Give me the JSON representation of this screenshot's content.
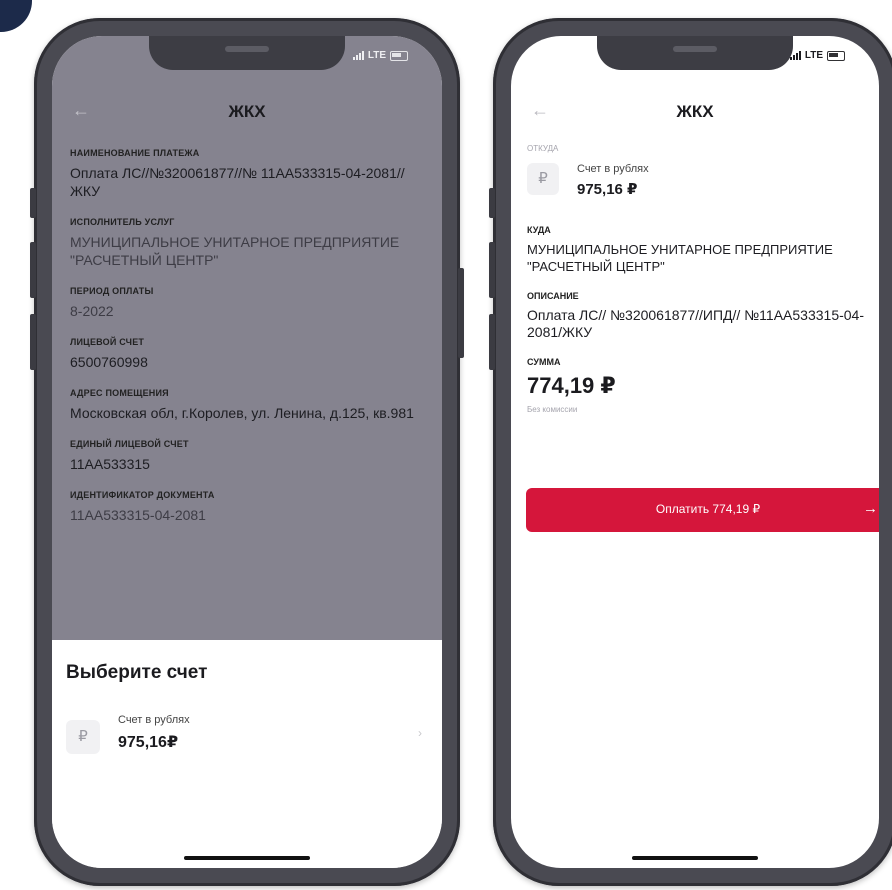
{
  "status": {
    "network": "LTE"
  },
  "left_screen": {
    "title": "ЖКХ",
    "fields": [
      {
        "label": "НАИМЕНОВАНИЕ ПЛАТЕЖА",
        "value": "Оплата ЛС//№320061877//№ 11АА533315-04-2081//ЖКУ"
      },
      {
        "label": "ИСПОЛНИТЕЛЬ УСЛУГ",
        "value": "МУНИЦИПАЛЬНОЕ УНИТАРНОЕ ПРЕДПРИЯТИЕ \"РАСЧЕТНЫЙ ЦЕНТР\""
      },
      {
        "label": "ПЕРИОД ОПЛАТЫ",
        "value": "8-2022"
      },
      {
        "label": "ЛИЦЕВОЙ СЧЕТ",
        "value": "6500760998"
      },
      {
        "label": "АДРЕС ПОМЕЩЕНИЯ",
        "value": "Московская обл, г.Королев, ул. Ленина, д.125, кв.981"
      },
      {
        "label": "ЕДИНЫЙ ЛИЦЕВОЙ СЧЕТ",
        "value": "11АА533315"
      },
      {
        "label": "ИДЕНТИФИКАТОР ДОКУМЕНТА",
        "value": "11АА533315-04-2081"
      }
    ],
    "sheet_title": "Выберите счет",
    "account": {
      "currency_symbol": "₽",
      "name": "Счет в рублях",
      "amount": "975,16₽"
    }
  },
  "right_screen": {
    "title": "ЖКХ",
    "from_label": "ОТКУДА",
    "account": {
      "currency_symbol": "₽",
      "name": "Счет в рублях",
      "amount": "975,16 ₽"
    },
    "to_label": "КУДА",
    "to_value": "МУНИЦИПАЛЬНОЕ УНИТАРНОЕ ПРЕДПРИЯТИЕ \"РАСЧЕТНЫЙ ЦЕНТР\"",
    "description_label": "ОПИСАНИЕ",
    "description_value": "Оплата ЛС// №320061877//ИПД// №11АА533315-04-2081/ЖКУ",
    "sum_label": "СУММА",
    "sum_value": "774,19 ₽",
    "fee_note": "Без комиссии",
    "pay_button": "Оплатить 774,19 ₽"
  },
  "colors": {
    "accent_red": "#d5163b",
    "overlay_gray": "#85838f",
    "phone_frame": "#4a4a52"
  },
  "icons": {
    "back": "arrow-left-icon",
    "chevron": "chevron-right-icon",
    "ruble": "ruble-icon",
    "pay_arrow": "arrow-right-icon"
  }
}
